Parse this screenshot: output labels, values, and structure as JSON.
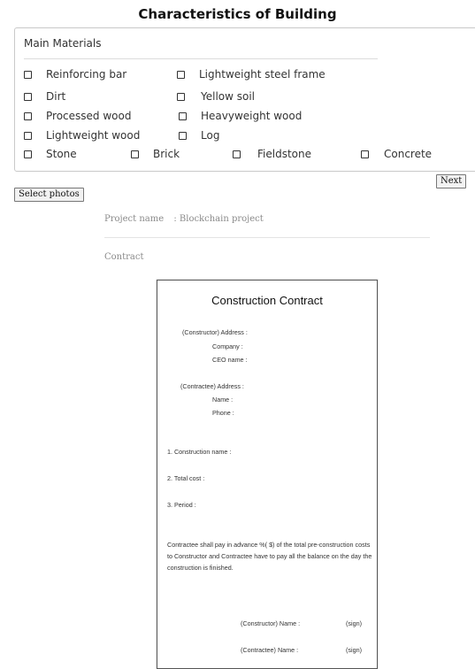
{
  "title": "Characteristics of Building",
  "materials": {
    "header": "Main Materials",
    "options": {
      "reinforcing_bar": "Reinforcing bar",
      "lightweight_steel_frame": "Lightweight steel frame",
      "dirt": "Dirt",
      "yellow_soil": "Yellow soil",
      "processed_wood": "Processed wood",
      "heavyweight_wood": "Heavyweight wood",
      "lightweight_wood": "Lightweight wood",
      "log": "Log",
      "stone": "Stone",
      "brick": "Brick",
      "fieldstone": "Fieldstone",
      "concrete": "Concrete"
    }
  },
  "buttons": {
    "next": "Next",
    "select_photos": "Select photos"
  },
  "project": {
    "name_label": "Project name",
    "name_value": ": Blockchain project",
    "contract_label": "Contract"
  },
  "contract_doc": {
    "title": "Construction Contract",
    "constructor_address": "(Constructor) Address :",
    "company": "Company :",
    "ceo_name": "CEO name :",
    "contractee_address": "(Contractee) Address :",
    "name": "Name :",
    "phone": "Phone :",
    "item1": "1. Construction name :",
    "item2": "2. Total cost :",
    "item3": "3. Period :",
    "paragraph": "Contractee shall pay in advance %(      $) of the total pre-construction costs to Constructor and Contractee have to pay all the balance on the day the construction is finished.",
    "constructor_sign": "(Constructor) Name :",
    "contractee_sign": "(Contractee) Name :",
    "sign": "(sign)"
  }
}
